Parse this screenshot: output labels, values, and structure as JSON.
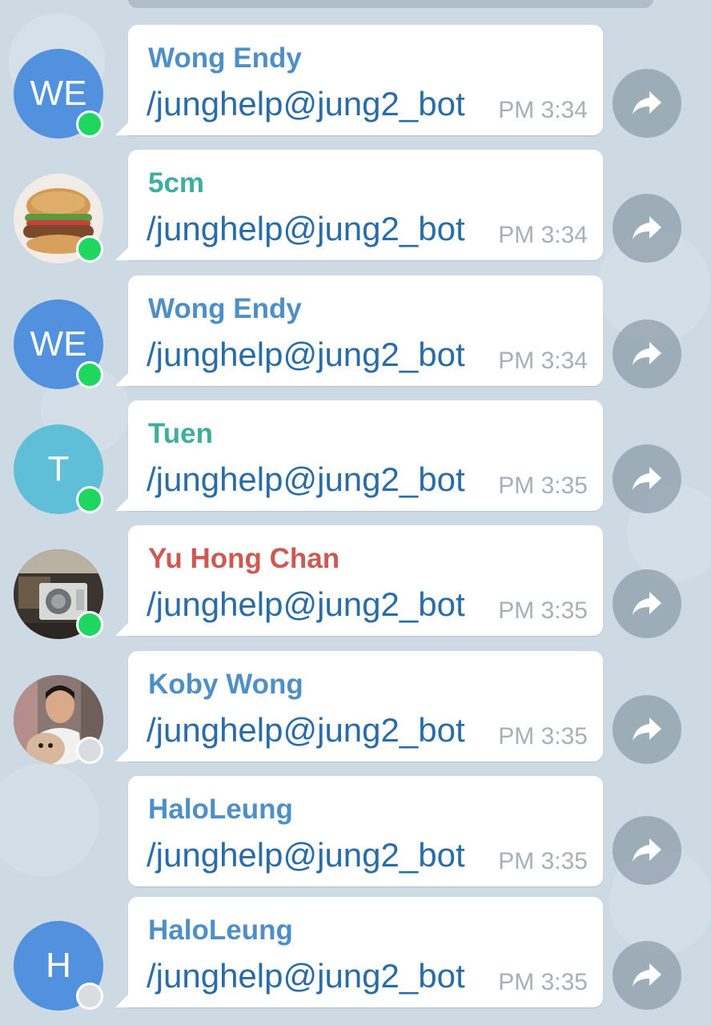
{
  "colors": {
    "online": "#1ed760",
    "offline": "#d9dde0",
    "sender_blue": "#4f8fc8",
    "sender_teal": "#3fae9e",
    "sender_red": "#cc5a54",
    "text": "#2a6ca8",
    "time": "#a6b0b8"
  },
  "messages": [
    {
      "sender": "Wong Endy",
      "text": "/junghelp@jung2_bot",
      "time": "PM 3:34",
      "avatar": {
        "type": "initials",
        "initials": "WE",
        "color": "#5191de"
      },
      "status": "online"
    },
    {
      "sender": "5cm",
      "text": "/junghelp@jung2_bot",
      "time": "PM 3:34",
      "avatar": {
        "type": "photo",
        "icon": "burger-photo"
      },
      "status": "online"
    },
    {
      "sender": "Wong Endy",
      "text": "/junghelp@jung2_bot",
      "time": "PM 3:34",
      "avatar": {
        "type": "initials",
        "initials": "WE",
        "color": "#5191de"
      },
      "status": "online"
    },
    {
      "sender": "Tuen",
      "text": "/junghelp@jung2_bot",
      "time": "PM 3:35",
      "avatar": {
        "type": "initials",
        "initials": "T",
        "color": "#5fbfd8"
      },
      "status": "online"
    },
    {
      "sender": "Yu Hong Chan",
      "text": "/junghelp@jung2_bot",
      "time": "PM 3:35",
      "avatar": {
        "type": "photo",
        "icon": "air-conditioner-photo"
      },
      "status": "online"
    },
    {
      "sender": "Koby Wong",
      "text": "/junghelp@jung2_bot",
      "time": "PM 3:35",
      "avatar": {
        "type": "photo",
        "icon": "person-with-dog-photo"
      },
      "status": "offline"
    },
    {
      "sender": "HaloLeung",
      "text": "/junghelp@jung2_bot",
      "time": "PM 3:35",
      "avatar": null,
      "status": null
    },
    {
      "sender": "HaloLeung",
      "text": "/junghelp@jung2_bot",
      "time": "PM 3:35",
      "avatar": {
        "type": "initials",
        "initials": "H",
        "color": "#5191de"
      },
      "status": "offline"
    }
  ]
}
